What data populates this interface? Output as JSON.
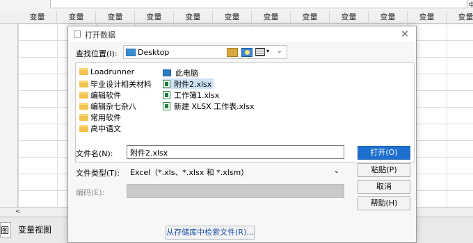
{
  "spreadsheet": {
    "column_header": "变量",
    "column_count": 12,
    "tabs": [
      "图",
      "变量视图"
    ],
    "scroll_left": "<",
    "top_right_glyph": "中"
  },
  "dialog": {
    "title": "打开数据",
    "close_glyph": "×",
    "look_in_label": "查找位置(I):",
    "look_in_value": "Desktop",
    "folders_col1": [
      "Loadrunner",
      "毕业设计相关材料",
      "编辑软件",
      "编辑杂七杂八",
      "常用软件",
      "高中语文"
    ],
    "items_col2": [
      {
        "name": "此电脑",
        "icon": "computer-icon"
      },
      {
        "name": "附件2.xlsx",
        "icon": "excel-file-icon",
        "selected": true
      },
      {
        "name": "工作簿1.xlsx",
        "icon": "excel-file-icon"
      },
      {
        "name": "新建 XLSX 工作表.xlsx",
        "icon": "excel-file-icon"
      }
    ],
    "file_name_label": "文件名(N):",
    "file_name_value": "附件2.xlsx",
    "file_type_label": "文件类型(T):",
    "file_type_value": "Excel（*.xls、*.xlsx 和 *.xlsm）",
    "encoding_label": "编码(E):",
    "buttons": {
      "open": "打开(O)",
      "paste": "粘贴(P)",
      "cancel": "取消",
      "help": "帮助(H)"
    },
    "repository_button": "从存储库中检索文件(R)...",
    "colors": {
      "primary": "#1e6fd0",
      "selection": "#cfe3f7"
    }
  }
}
